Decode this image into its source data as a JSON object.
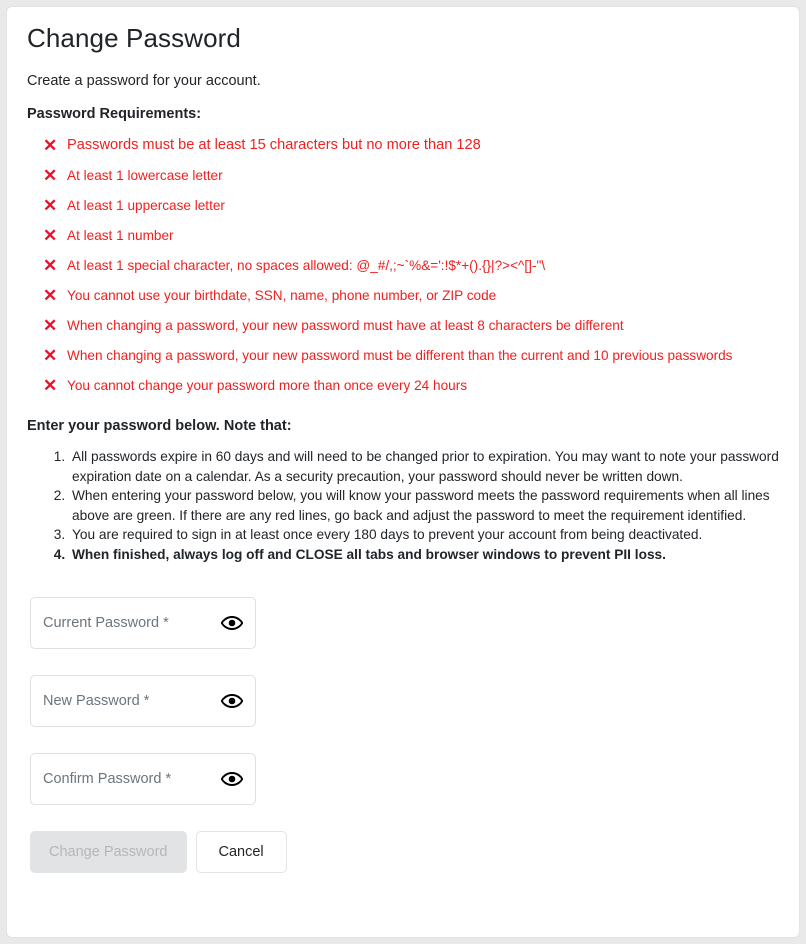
{
  "page": {
    "title": "Change Password",
    "intro": "Create a password for your account."
  },
  "requirements": {
    "heading": "Password Requirements:",
    "status_icon": "✕",
    "items": [
      "Passwords must be at least 15 characters but no more than 128",
      "At least 1 lowercase letter",
      "At least 1 uppercase letter",
      "At least 1 number",
      "At least 1 special character, no spaces allowed: @_#/,;~`%&=':!$*+().{}|?><^[]-\"\\",
      "You cannot use your birthdate, SSN, name, phone number, or ZIP code",
      "When changing a password, your new password must have at least 8 characters be different",
      "When changing a password, your new password must be different than the current and 10 previous passwords",
      "You cannot change your password more than once every 24 hours"
    ]
  },
  "notes": {
    "heading": "Enter your password below. Note that:",
    "items": [
      "All passwords expire in 60 days and will need to be changed prior to expiration. You may want to note your password expiration date on a calendar. As a security precaution, your password should never be written down.",
      "When entering your password below, you will know your password meets the password requirements when all lines above are green. If there are any red lines, go back and adjust the password to meet the requirement identified.",
      "You are required to sign in at least once every 180 days to prevent your account from being deactivated.",
      "When finished, always log off and CLOSE all tabs and browser windows to prevent PII loss."
    ]
  },
  "form": {
    "current_password": {
      "label": "Current Password *",
      "value": ""
    },
    "new_password": {
      "label": "New Password *",
      "value": ""
    },
    "confirm_password": {
      "label": "Confirm Password *",
      "value": ""
    }
  },
  "actions": {
    "submit_label": "Change Password",
    "cancel_label": "Cancel"
  },
  "colors": {
    "error": "#ef2020",
    "text": "#212529",
    "placeholder": "#6c757d",
    "disabled_bg": "#e2e3e5",
    "background": "#e9e9e9"
  }
}
